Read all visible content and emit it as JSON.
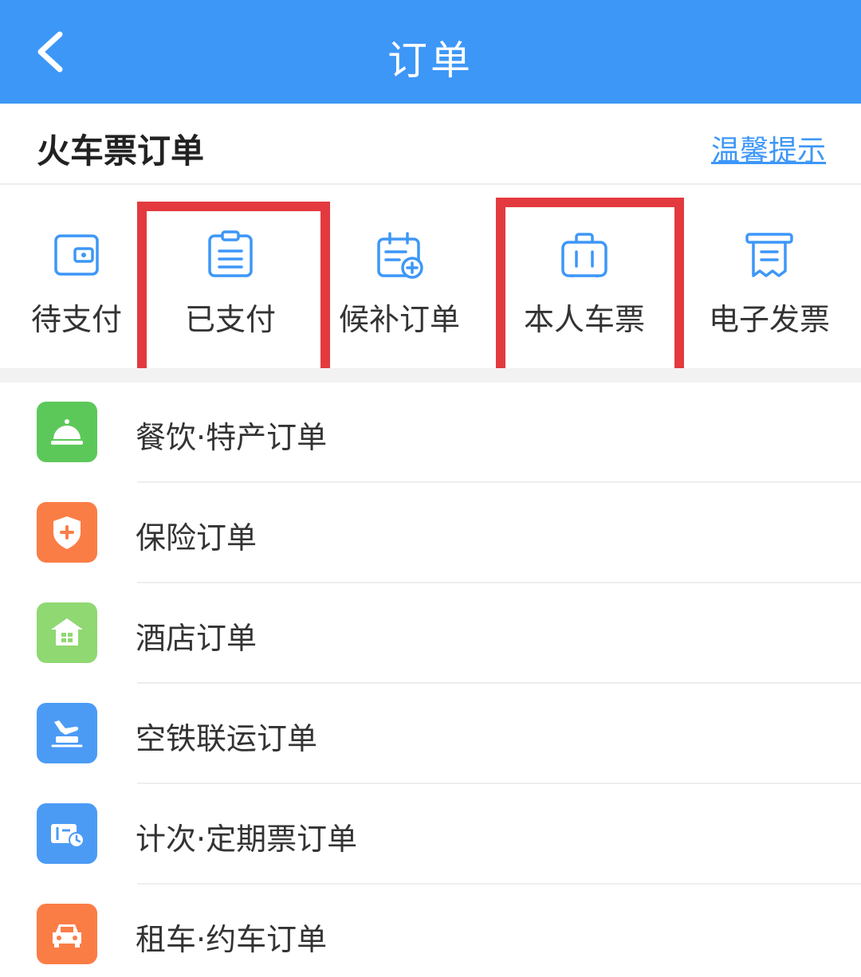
{
  "header": {
    "title": "订单",
    "back_icon": "chevron-left-icon"
  },
  "section": {
    "title": "火车票订单",
    "tips_link": "温馨提示"
  },
  "quick_actions": [
    {
      "label": "待支付",
      "icon": "wallet-icon"
    },
    {
      "label": "已支付",
      "icon": "clipboard-icon"
    },
    {
      "label": "候补订单",
      "icon": "calendar-add-icon"
    },
    {
      "label": "本人车票",
      "icon": "suitcase-icon"
    },
    {
      "label": "电子发票",
      "icon": "receipt-icon"
    }
  ],
  "list": [
    {
      "label": "餐饮·特产订单",
      "icon": "service-bell-icon",
      "color": "#5cc85a"
    },
    {
      "label": "保险订单",
      "icon": "shield-plus-icon",
      "color": "#fb7d46"
    },
    {
      "label": "酒店订单",
      "icon": "hotel-icon",
      "color": "#8fd872"
    },
    {
      "label": "空铁联运订单",
      "icon": "plane-train-icon",
      "color": "#4b9bf5"
    },
    {
      "label": "计次·定期票订单",
      "icon": "ticket-clock-icon",
      "color": "#4b9bf5"
    },
    {
      "label": "租车·约车订单",
      "icon": "car-icon",
      "color": "#fb7d46"
    }
  ],
  "colors": {
    "header": "#3d97f7",
    "highlight": "#e23a3f",
    "icon_stroke": "#3d97f7"
  }
}
